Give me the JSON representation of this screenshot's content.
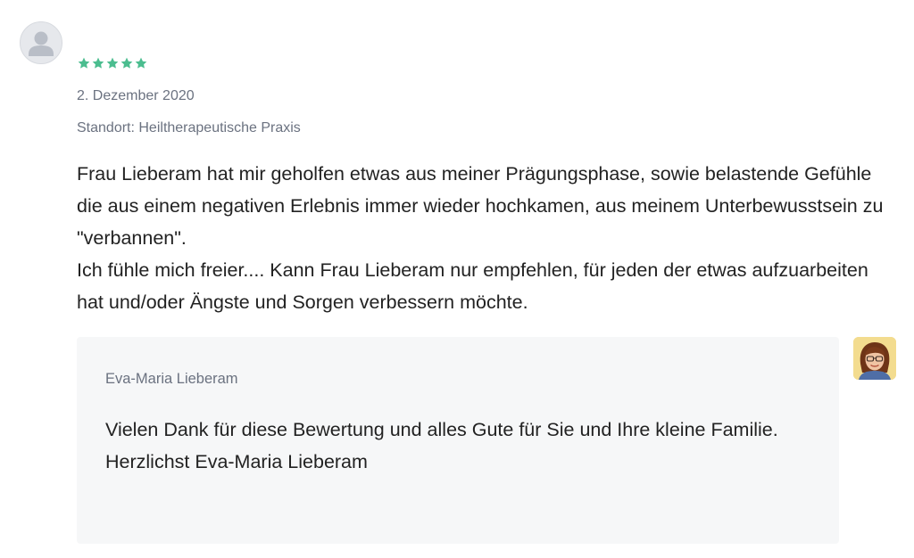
{
  "review": {
    "rating": 5,
    "rating_max": 5,
    "star_color": "#4bbd8f",
    "date": "2. Dezember 2020",
    "location": "Standort: Heiltherapeutische Praxis",
    "paragraphs": [
      "Frau Lieberam hat mir geholfen etwas aus meiner Prägungsphase, sowie belastende Gefühle die aus einem negativen Erlebnis immer wieder hochkamen, aus meinem Unterbewusstsein zu \"verbannen\".",
      "Ich fühle mich freier.... Kann Frau Lieberam nur empfehlen, für jeden der etwas aufzuarbeiten hat und/oder Ängste und Sorgen verbessern möchte."
    ]
  },
  "reply": {
    "author": "Eva-Maria Lieberam",
    "paragraphs": [
      "Vielen Dank für diese Bewertung und alles Gute für Sie und Ihre kleine Familie.",
      "Herzlichst Eva-Maria Lieberam"
    ]
  },
  "icons": {
    "reviewer_avatar": "user-placeholder-icon",
    "star": "star-icon",
    "owner_avatar": "owner-photo"
  }
}
